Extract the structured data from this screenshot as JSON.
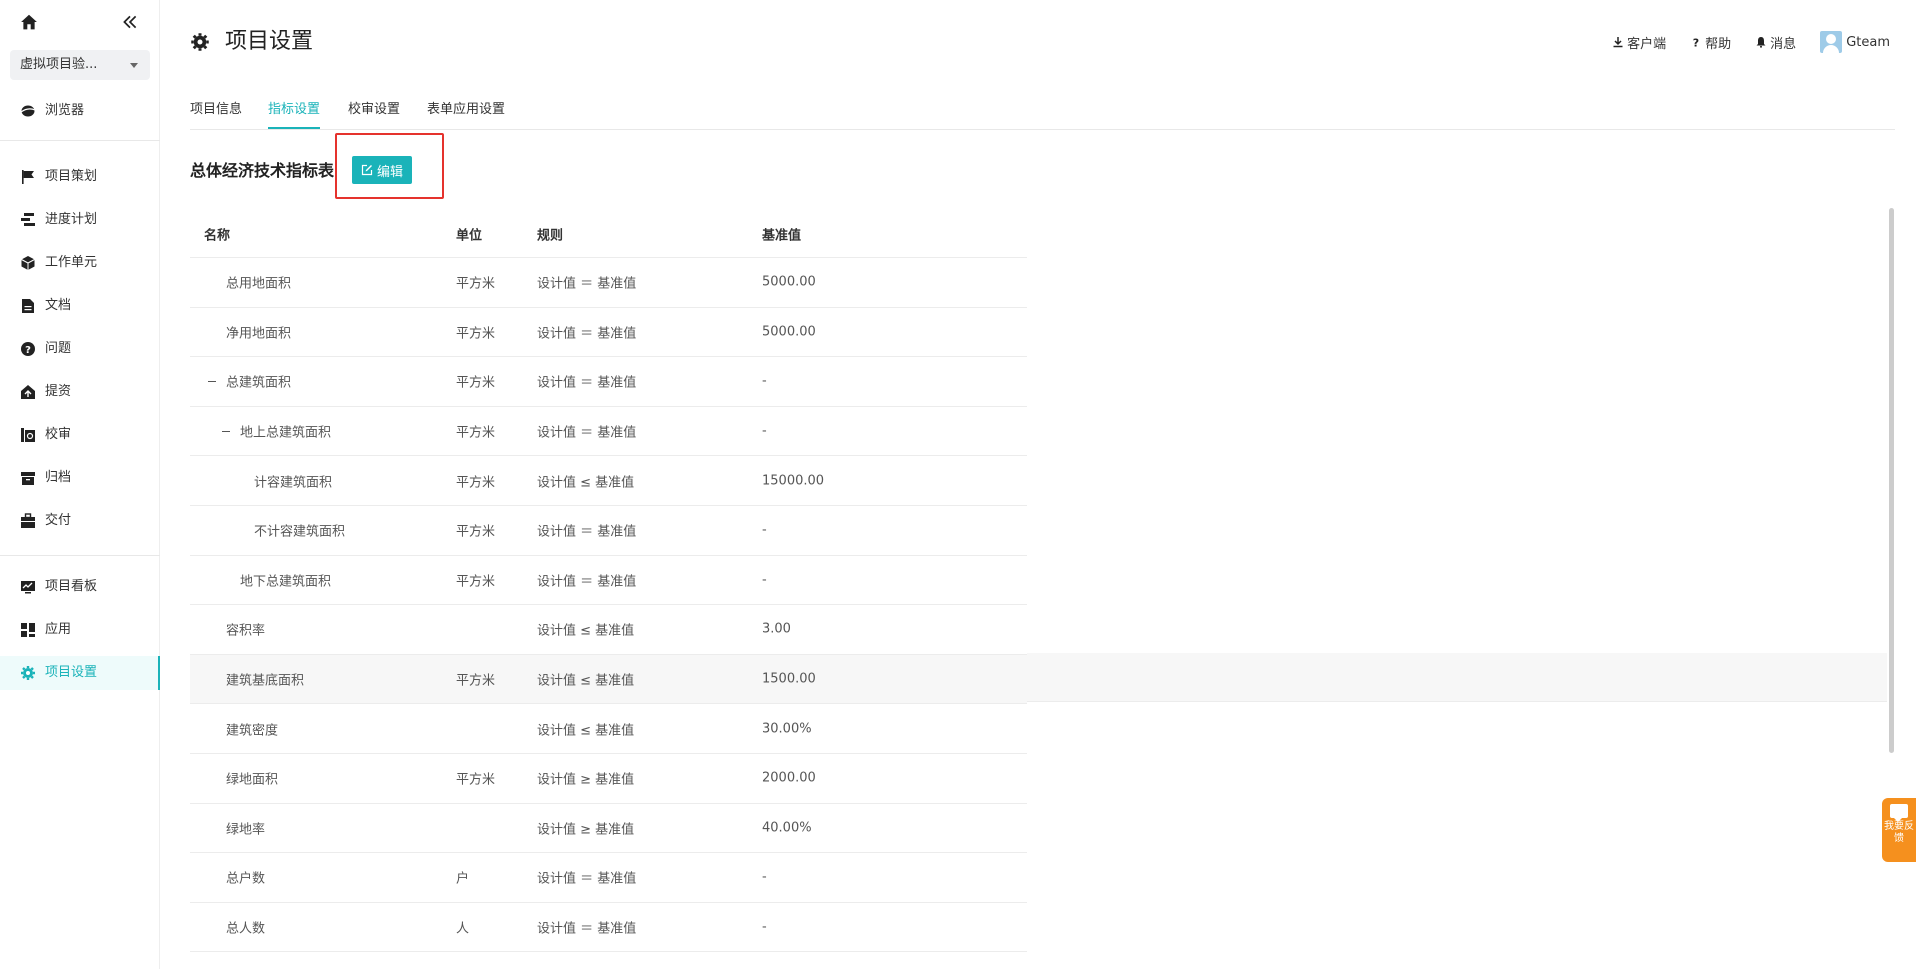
{
  "sidebar": {
    "project_select": "虚拟项目验...",
    "items": [
      {
        "label": "浏览器",
        "icon": "globe-icon"
      },
      {
        "label": "项目策划",
        "icon": "flag-icon"
      },
      {
        "label": "进度计划",
        "icon": "gantt-icon"
      },
      {
        "label": "工作单元",
        "icon": "cube-icon"
      },
      {
        "label": "文档",
        "icon": "document-icon"
      },
      {
        "label": "问题",
        "icon": "question-icon"
      },
      {
        "label": "提资",
        "icon": "submit-icon"
      },
      {
        "label": "校审",
        "icon": "review-icon"
      },
      {
        "label": "归档",
        "icon": "archive-icon"
      },
      {
        "label": "交付",
        "icon": "briefcase-icon"
      },
      {
        "label": "项目看板",
        "icon": "dashboard-icon"
      },
      {
        "label": "应用",
        "icon": "apps-icon"
      },
      {
        "label": "项目设置",
        "icon": "gear-icon"
      }
    ]
  },
  "header": {
    "title": "项目设置",
    "client": "客户端",
    "help": "帮助",
    "messages": "消息",
    "user": "Gteam"
  },
  "tabs": [
    "项目信息",
    "指标设置",
    "校审设置",
    "表单应用设置"
  ],
  "active_tab": "指标设置",
  "section": {
    "title": "总体经济技术指标表",
    "edit_label": "编辑"
  },
  "table": {
    "headers": [
      "名称",
      "单位",
      "规则",
      "基准值"
    ],
    "rows": [
      {
        "name": "总用地面积",
        "unit": "平方米",
        "rule": "设计值 ＝ 基准值",
        "base": "5000.00",
        "level": 1,
        "toggle": false
      },
      {
        "name": "净用地面积",
        "unit": "平方米",
        "rule": "设计值 ＝ 基准值",
        "base": "5000.00",
        "level": 1,
        "toggle": false
      },
      {
        "name": "总建筑面积",
        "unit": "平方米",
        "rule": "设计值 ＝ 基准值",
        "base": "-",
        "level": 1,
        "toggle": true
      },
      {
        "name": "地上总建筑面积",
        "unit": "平方米",
        "rule": "设计值 ＝ 基准值",
        "base": "-",
        "level": 2,
        "toggle": true
      },
      {
        "name": "计容建筑面积",
        "unit": "平方米",
        "rule": "设计值 ≤ 基准值",
        "base": "15000.00",
        "level": 3,
        "toggle": false
      },
      {
        "name": "不计容建筑面积",
        "unit": "平方米",
        "rule": "设计值 ＝ 基准值",
        "base": "-",
        "level": 3,
        "toggle": false
      },
      {
        "name": "地下总建筑面积",
        "unit": "平方米",
        "rule": "设计值 ＝ 基准值",
        "base": "-",
        "level": 2,
        "toggle": false
      },
      {
        "name": "容积率",
        "unit": "",
        "rule": "设计值 ≤ 基准值",
        "base": "3.00",
        "level": 1,
        "toggle": false
      },
      {
        "name": "建筑基底面积",
        "unit": "平方米",
        "rule": "设计值 ≤ 基准值",
        "base": "1500.00",
        "level": 1,
        "toggle": false,
        "highlight": true
      },
      {
        "name": "建筑密度",
        "unit": "",
        "rule": "设计值 ≤ 基准值",
        "base": "30.00%",
        "level": 1,
        "toggle": false
      },
      {
        "name": "绿地面积",
        "unit": "平方米",
        "rule": "设计值 ≥ 基准值",
        "base": "2000.00",
        "level": 1,
        "toggle": false
      },
      {
        "name": "绿地率",
        "unit": "",
        "rule": "设计值 ≥ 基准值",
        "base": "40.00%",
        "level": 1,
        "toggle": false
      },
      {
        "name": "总户数",
        "unit": "户",
        "rule": "设计值 ＝ 基准值",
        "base": "-",
        "level": 1,
        "toggle": false
      },
      {
        "name": "总人数",
        "unit": "人",
        "rule": "设计值 ＝ 基准值",
        "base": "-",
        "level": 1,
        "toggle": false
      }
    ]
  },
  "feedback": "我要反馈",
  "colors": {
    "accent": "#1ab3b9",
    "highlight_border": "#e5322d",
    "feedback": "#f5901e"
  }
}
